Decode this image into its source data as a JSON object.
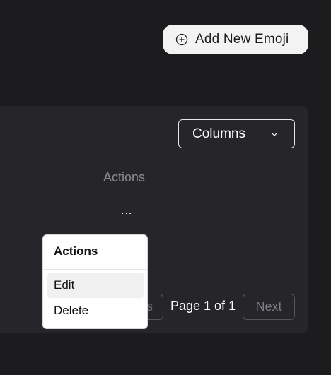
{
  "header": {
    "add_button_label": "Add New Emoji"
  },
  "table": {
    "columns_button_label": "Columns",
    "actions_header": "Actions",
    "row_actions_trigger": "..."
  },
  "pagination": {
    "previous_label_visible": "s",
    "page_indicator": "Page 1 of 1",
    "next_label": "Next"
  },
  "actions_menu": {
    "heading": "Actions",
    "items": [
      {
        "label": "Edit",
        "highlighted": true
      },
      {
        "label": "Delete",
        "highlighted": false
      }
    ]
  },
  "icons": {
    "add": "plus-circle-icon",
    "columns_dropdown": "chevron-down-icon"
  },
  "colors": {
    "background": "#1c1c1f",
    "panel": "#26262a",
    "primary_button": "#f3f3f3",
    "muted_text": "#8a8a90"
  }
}
